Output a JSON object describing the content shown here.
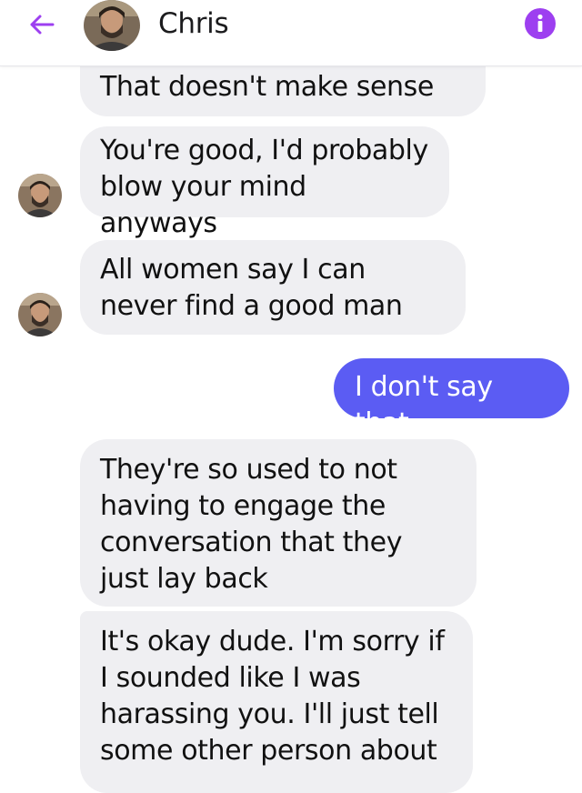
{
  "header": {
    "contact_name": "Chris"
  },
  "messages": [
    {
      "from": "them",
      "text": "That doesn't make sense"
    },
    {
      "from": "them",
      "text": "You're good, I'd probably blow your mind anyways"
    },
    {
      "from": "them",
      "text": "All women say I can never find a good man"
    },
    {
      "from": "me",
      "text": "I don't say that"
    },
    {
      "from": "them",
      "text": "They're so used to not having to engage the conversation that they just lay back"
    },
    {
      "from": "them",
      "text": "It's okay dude. I'm sorry if I sounded like I was harassing you. I'll just tell some other person about"
    }
  ],
  "colors": {
    "accent": "#9d3ff0",
    "outgoing_bubble": "#5b5cf3",
    "incoming_bubble": "#efeff2"
  },
  "icons": {
    "back": "arrow-left-icon",
    "info": "info-icon"
  }
}
